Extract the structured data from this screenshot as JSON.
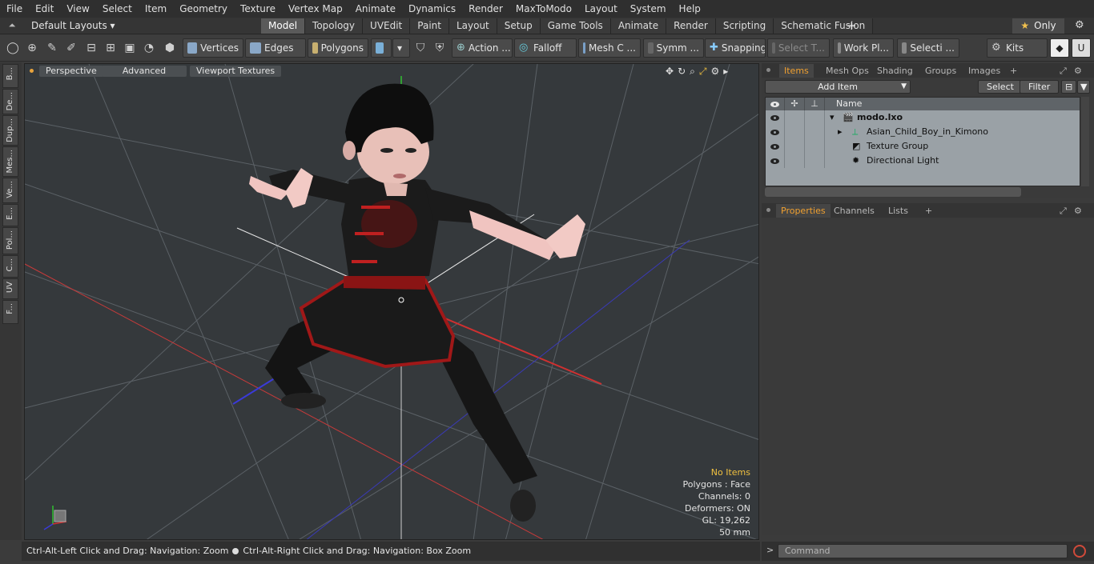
{
  "menu": [
    "File",
    "Edit",
    "View",
    "Select",
    "Item",
    "Geometry",
    "Texture",
    "Vertex Map",
    "Animate",
    "Dynamics",
    "Render",
    "MaxToModo",
    "Layout",
    "System",
    "Help"
  ],
  "layout": {
    "selector": "Default Layouts ▾",
    "tabs": [
      "Model",
      "Topology",
      "UVEdit",
      "Paint",
      "Layout",
      "Setup",
      "Game Tools",
      "Animate",
      "Render",
      "Scripting",
      "Schematic Fusion"
    ],
    "active_tab": "Model",
    "plus": "+",
    "only_label": "Only"
  },
  "toolbar": {
    "vertices": "Vertices",
    "edges": "Edges",
    "polygons": "Polygons",
    "action": "Action ...",
    "falloff": "Falloff",
    "mesh": "Mesh C ...",
    "symm": "Symm ...",
    "snapping": "Snapping",
    "select_t": "Select T...",
    "work_plane": "Work Pl...",
    "selecti": "Selecti ...",
    "kits": "Kits"
  },
  "left_tabs": [
    "B...",
    "De...",
    "Dup...",
    "Mes...",
    "Ve...",
    "E...",
    "Pol...",
    "C...",
    "UV",
    "F..."
  ],
  "viewport": {
    "view_mode": "Perspective",
    "shading": "Advanced",
    "textures": "Viewport Textures",
    "stats": {
      "selection": "No Items",
      "polygons": "Polygons : Face",
      "channels": "Channels: 0",
      "deformers": "Deformers: ON",
      "gl": "GL: 19,262",
      "focal": "50 mm"
    }
  },
  "status": {
    "hint_left": "Ctrl-Alt-Left Click and Drag: Navigation: Zoom",
    "hint_right": "Ctrl-Alt-Right Click and Drag: Navigation: Box Zoom"
  },
  "items_panel": {
    "tabs": [
      "Items",
      "Mesh Ops",
      "Shading",
      "Groups",
      "Images"
    ],
    "active_tab": "Items",
    "add_item": "Add Item",
    "select": "Select",
    "filter": "Filter",
    "column_name": "Name",
    "tree": [
      {
        "name": "modo.lxo",
        "bold": true,
        "indent": 0
      },
      {
        "name": "Asian_Child_Boy_in_Kimono",
        "bold": false,
        "indent": 1
      },
      {
        "name": "Texture Group",
        "bold": false,
        "indent": 1
      },
      {
        "name": "Directional Light",
        "bold": false,
        "indent": 1
      }
    ]
  },
  "properties_panel": {
    "tabs": [
      "Properties",
      "Channels",
      "Lists"
    ],
    "active_tab": "Properties"
  },
  "command": {
    "placeholder": "Command"
  },
  "colors": {
    "accent": "#f0a030",
    "viewport_bg": "#35393c",
    "x_axis": "#c83a3a",
    "y_axis": "#3ac83a",
    "z_axis": "#3a3ac8"
  }
}
